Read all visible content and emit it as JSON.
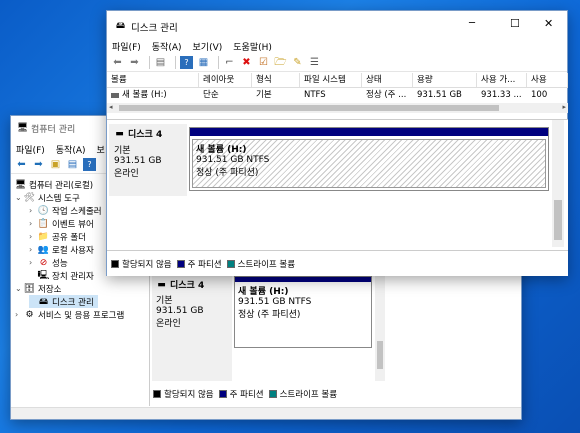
{
  "back_window": {
    "title": "컴퓨터 관리",
    "menu": [
      "파일(F)",
      "동작(A)",
      "보"
    ],
    "tree": [
      {
        "label": "컴퓨터 관리(로컬)",
        "icon": "computer-icon",
        "expander": ""
      },
      {
        "label": "시스템 도구",
        "icon": "tools-icon",
        "expander": "⌄"
      },
      {
        "label": "작업 스케줄러",
        "icon": "clock-icon",
        "expander": "›"
      },
      {
        "label": "이벤트 뷰어",
        "icon": "event-icon",
        "expander": "›"
      },
      {
        "label": "공유 폴더",
        "icon": "folder-icon",
        "expander": "›"
      },
      {
        "label": "로컬 사용자",
        "icon": "users-icon",
        "expander": "›"
      },
      {
        "label": "성능",
        "icon": "performance-icon",
        "expander": "›"
      },
      {
        "label": "장치 관리자",
        "icon": "device-icon",
        "expander": ""
      },
      {
        "label": "저장소",
        "icon": "storage-icon",
        "expander": "⌄"
      },
      {
        "label": "디스크 관리",
        "icon": "disk-icon",
        "expander": ""
      },
      {
        "label": "서비스 및 응용 프로그램",
        "icon": "services-icon",
        "expander": "›"
      }
    ],
    "disk": {
      "name": "디스크 4",
      "type": "기본",
      "size": "931.51 GB",
      "status": "온라인"
    },
    "volume": {
      "name": "새 볼륨  (H:)",
      "fs": "931.51 GB NTFS",
      "state": "정상 (주 파티션)"
    },
    "legend": [
      {
        "label": "할당되지 않음",
        "color": "#000000"
      },
      {
        "label": "주 파티션",
        "color": "#00007f"
      },
      {
        "label": "스트라이프 볼륨",
        "color": "#008080"
      }
    ]
  },
  "front_window": {
    "title": "디스크 관리",
    "menu": [
      "파일(F)",
      "동작(A)",
      "보기(V)",
      "도움말(H)"
    ],
    "controls": {
      "minimize": "─",
      "maximize": "☐",
      "close": "✕"
    },
    "columns": [
      "볼륨",
      "레이아웃",
      "형식",
      "파일 시스템",
      "상태",
      "용량",
      "사용 가...",
      "사용"
    ],
    "rows": [
      [
        "새 볼륨 (H:)",
        "단순",
        "기본",
        "NTFS",
        "정상 (주 ...",
        "931.51 GB",
        "931.33 ...",
        "100"
      ]
    ],
    "disk": {
      "name": "디스크 4",
      "type": "기본",
      "size": "931.51 GB",
      "status": "온라인"
    },
    "volume": {
      "name": "새 볼륨  (H:)",
      "fs": "931.51 GB NTFS",
      "state": "정상 (주 파티션)"
    },
    "legend": [
      {
        "label": "할당되지 않음",
        "color": "#000000"
      },
      {
        "label": "주 파티션",
        "color": "#00007f"
      },
      {
        "label": "스트라이프 볼륨",
        "color": "#008080"
      }
    ],
    "accent": "#00007f"
  }
}
